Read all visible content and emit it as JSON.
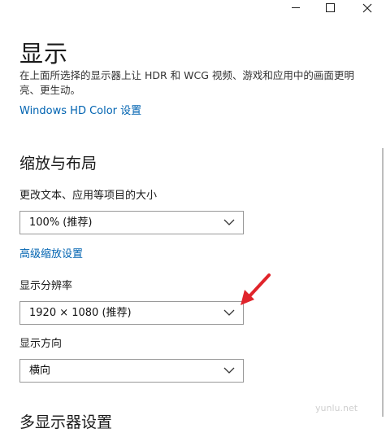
{
  "window": {
    "minimize_icon": "minimize-icon",
    "maximize_icon": "maximize-icon",
    "close_icon": "close-icon"
  },
  "page": {
    "title": "显示",
    "description": "在上面所选择的显示器上让 HDR 和 WCG 视频、游戏和应用中的画面更明亮、更生动。",
    "hdr_link": "Windows HD Color 设置"
  },
  "scale_layout": {
    "section_title": "缩放与布局",
    "scale_label": "更改文本、应用等项目的大小",
    "scale_value": "100% (推荐)",
    "advanced_link": "高级缩放设置",
    "resolution_label": "显示分辨率",
    "resolution_value": "1920 × 1080 (推荐)",
    "orientation_label": "显示方向",
    "orientation_value": "横向"
  },
  "multi_display": {
    "section_title": "多显示器设置"
  },
  "watermark": "yunlu.net",
  "colors": {
    "accent_link": "#0063b1",
    "annotation_arrow": "#e0242b"
  }
}
